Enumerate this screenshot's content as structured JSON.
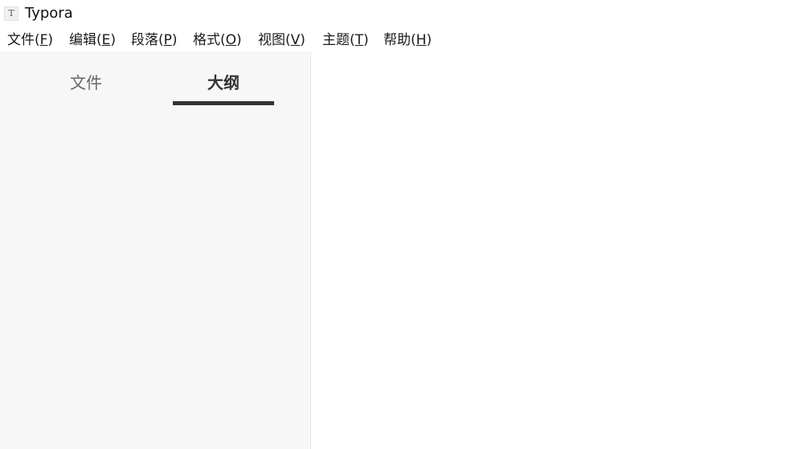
{
  "window": {
    "icon_glyph": "T",
    "title": "Typora"
  },
  "menu": [
    {
      "label": "文件(",
      "key": "F",
      "tail": ")"
    },
    {
      "label": "编辑(",
      "key": "E",
      "tail": ")"
    },
    {
      "label": "段落(",
      "key": "P",
      "tail": ")"
    },
    {
      "label": "格式(",
      "key": "O",
      "tail": ")"
    },
    {
      "label": "视图(",
      "key": "V",
      "tail": ")"
    },
    {
      "label": "主题(",
      "key": "T",
      "tail": ")"
    },
    {
      "label": "帮助(",
      "key": "H",
      "tail": ")"
    }
  ],
  "sidebar": {
    "tabs": [
      {
        "label": "文件",
        "active": false
      },
      {
        "label": "大纲",
        "active": true
      }
    ]
  },
  "colors": {
    "sidebar_bg": "#f7f7f7",
    "active_tab_indicator": "#333333",
    "editor_bg": "#ffffff"
  }
}
